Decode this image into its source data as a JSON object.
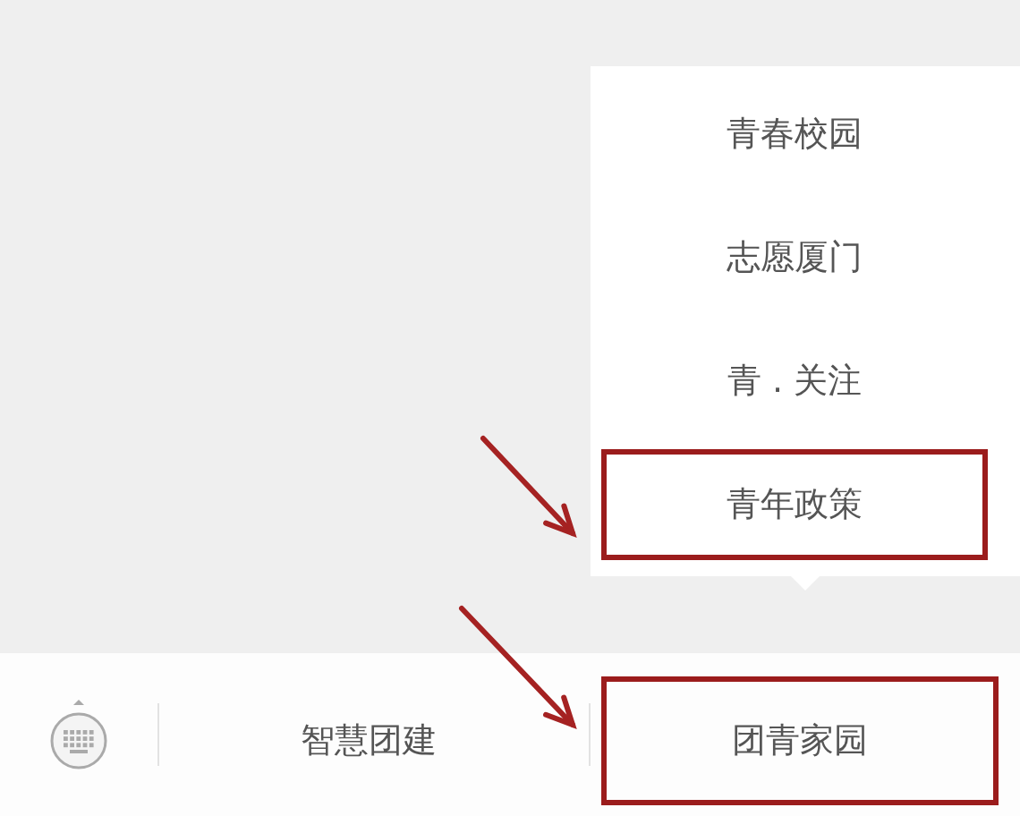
{
  "popup_menu": {
    "items": [
      {
        "label": "青春校园",
        "highlighted": false
      },
      {
        "label": "志愿厦门",
        "highlighted": false
      },
      {
        "label": "青 . 关注",
        "highlighted": false
      },
      {
        "label": "青年政策",
        "highlighted": true
      }
    ]
  },
  "bottom_menu": {
    "items": [
      {
        "label": "智慧团建",
        "highlighted": false
      },
      {
        "label": "团青家园",
        "highlighted": true
      }
    ]
  }
}
